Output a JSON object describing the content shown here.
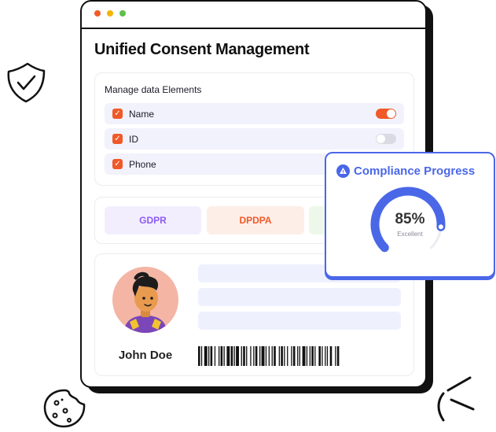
{
  "window": {
    "title": "Unified Consent Management",
    "dots": [
      "#f05a28",
      "#f5b400",
      "#5cc04a"
    ]
  },
  "manage": {
    "title": "Manage data Elements",
    "items": [
      {
        "label": "Name",
        "checked": true,
        "toggle_on": true
      },
      {
        "label": "ID",
        "checked": true,
        "toggle_on": false
      },
      {
        "label": "Phone",
        "checked": true
      }
    ]
  },
  "tags": [
    {
      "label": "GDPR",
      "color": "#8a5cf5",
      "bg": "#f3eefe"
    },
    {
      "label": "DPDPA",
      "color": "#f05a28",
      "bg": "#fdeee8"
    },
    {
      "label": "",
      "color": "#5cc04a",
      "bg": "#eef8ea"
    }
  ],
  "profile": {
    "name": "John Doe"
  },
  "compliance": {
    "title": "Compliance Progress",
    "value": "85%",
    "progress": 0.85,
    "status": "Excellent",
    "accent": "#4a67e8"
  },
  "colors": {
    "checkbox": "#f05a28",
    "toggle_on": "#f05a28",
    "toggle_off": "#d9dae3"
  },
  "decorations": [
    "shield-check-icon",
    "cookie-icon",
    "sparkle-lines-icon"
  ]
}
